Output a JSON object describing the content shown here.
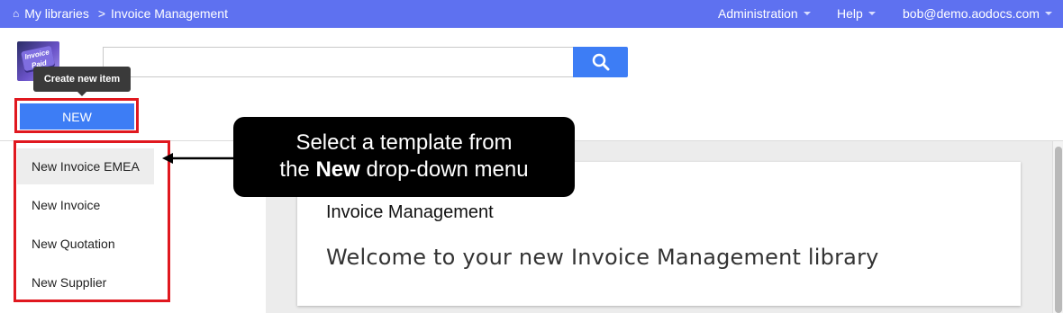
{
  "topbar": {
    "breadcrumb_root": "My libraries",
    "breadcrumb_sep": ">",
    "breadcrumb_current": "Invoice Management",
    "admin_label": "Administration",
    "help_label": "Help",
    "user_label": "bob@demo.aodocs.com",
    "bg_color": "#5e71f0"
  },
  "logo": {
    "text_line1": "Invoice",
    "text_line2": "Paid"
  },
  "search": {
    "value": "",
    "placeholder": ""
  },
  "tooltip": {
    "label": "Create new item"
  },
  "new_button": {
    "label": "NEW"
  },
  "menu": {
    "items": [
      {
        "label": "New Invoice EMEA"
      },
      {
        "label": "New Invoice"
      },
      {
        "label": "New Quotation"
      },
      {
        "label": "New Supplier"
      }
    ]
  },
  "callout": {
    "line1": "Select a template from",
    "line2_prefix": "the ",
    "line2_bold": "New",
    "line2_suffix": " drop-down menu"
  },
  "card": {
    "title": "Invoice Management",
    "welcome": "Welcome to your new Invoice Management library"
  },
  "colors": {
    "accent": "#3d7df5",
    "highlight_border": "#e0181f"
  }
}
